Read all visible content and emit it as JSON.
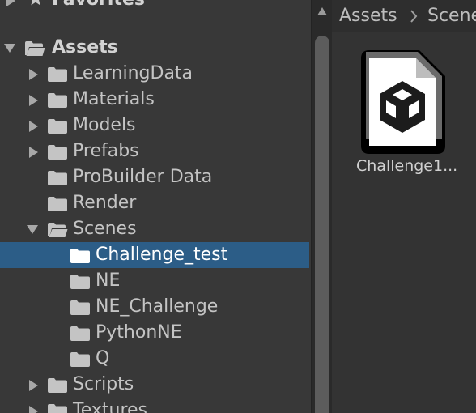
{
  "favorites": {
    "label": "Favorites"
  },
  "tree": {
    "assets_label": "Assets",
    "items": [
      {
        "label": "LearningData"
      },
      {
        "label": "Materials"
      },
      {
        "label": "Models"
      },
      {
        "label": "Prefabs"
      },
      {
        "label": "ProBuilder Data"
      },
      {
        "label": "Render"
      },
      {
        "label": "Scenes"
      }
    ],
    "scenes_children": [
      {
        "label": "Challenge_test"
      },
      {
        "label": "NE"
      },
      {
        "label": "NE_Challenge"
      },
      {
        "label": "PythonNE"
      },
      {
        "label": "Q"
      }
    ],
    "after": [
      {
        "label": "Scripts"
      },
      {
        "label": "Textures"
      }
    ]
  },
  "breadcrumb": {
    "root": "Assets",
    "current": "Scenes"
  },
  "asset": {
    "name": "Challenge1..."
  },
  "colors": {
    "selection": "#2c5d87",
    "panel": "#383838",
    "background": "#282828"
  }
}
